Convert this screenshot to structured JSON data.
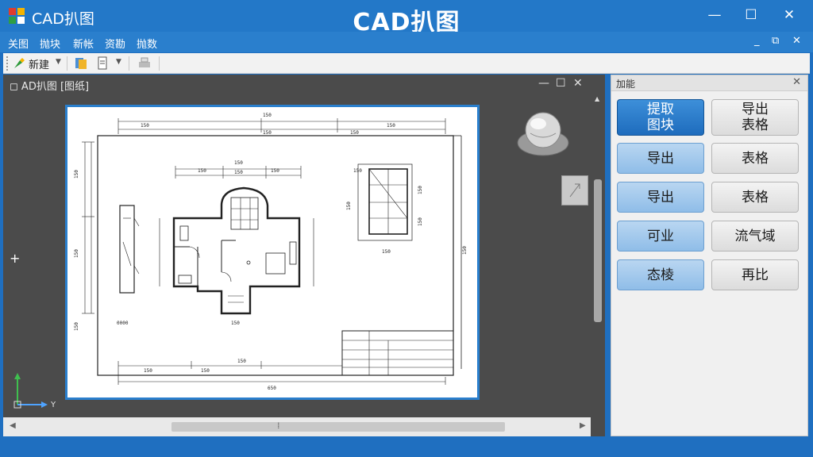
{
  "app": {
    "name": "CAD扒图",
    "window_title": "CAD扒图"
  },
  "window_controls": {
    "minimize": "—",
    "maximize": "☐",
    "close": "✕"
  },
  "menu": {
    "items": [
      "关图",
      "抛块",
      "新帐",
      "资勘",
      "抛数"
    ],
    "controls": {
      "minimize": "_",
      "restore": "⧉",
      "close": "✕"
    }
  },
  "toolbar": {
    "new_label": "新建"
  },
  "drawing": {
    "tab_label": "◻ AD扒图 [图纸]",
    "controls": {
      "minimize": "—",
      "maximize": "☐",
      "close": "✕"
    },
    "dims": {
      "top_row1": [
        "150",
        "150",
        "150"
      ],
      "top_row2": [
        "150",
        "150",
        "150",
        "150"
      ],
      "top_row3": [
        "150",
        "150",
        "150"
      ],
      "bottom_row1": [
        "150",
        "150",
        "150"
      ],
      "bottom_total": "650",
      "left_col": [
        "150",
        "150",
        "150"
      ],
      "elev_left": [
        "150",
        "150"
      ],
      "elev_right": [
        "150",
        "150"
      ],
      "stair_bottom": "150",
      "door_bottom": "150",
      "side_label": "0000"
    }
  },
  "right_panel": {
    "title": "加能",
    "buttons": [
      {
        "label": "提取\n图块",
        "style": "primary"
      },
      {
        "label": "导出\n表格",
        "style": "gray"
      },
      {
        "label": "导出",
        "style": "blue"
      },
      {
        "label": "表格",
        "style": "gray"
      },
      {
        "label": "导出",
        "style": "blue"
      },
      {
        "label": "表格",
        "style": "gray"
      },
      {
        "label": "可业",
        "style": "blue"
      },
      {
        "label": "流气域",
        "style": "gray"
      },
      {
        "label": "态棱",
        "style": "blue"
      },
      {
        "label": "再比",
        "style": "gray"
      }
    ]
  },
  "colors": {
    "accent": "#2378c8",
    "canvas": "#4b4b4b",
    "button_blue": "#8fbde8"
  }
}
